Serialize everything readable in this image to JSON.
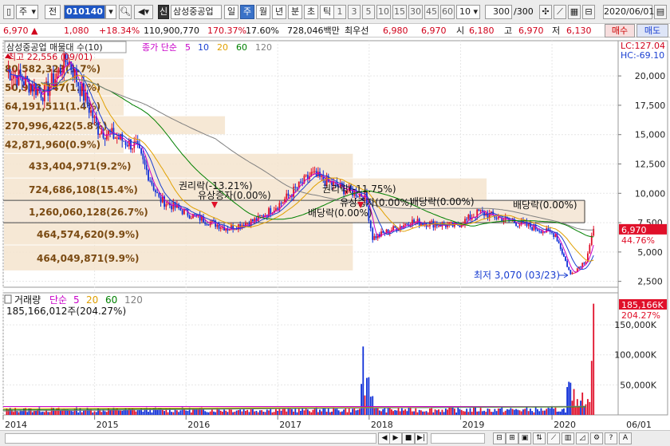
{
  "toolbar": {
    "period_select": "주",
    "prefix_btn": "전",
    "code": "010140",
    "stock_badge": "신",
    "stock_name": "삼성중공업",
    "intervals": [
      "일",
      "주",
      "월",
      "년",
      "분",
      "초",
      "틱"
    ],
    "active_interval": "주",
    "numbers": [
      "1",
      "3",
      "5",
      "10",
      "15",
      "30",
      "45",
      "60"
    ],
    "count_select": "10",
    "range_value": "300",
    "range_total": "/300",
    "date": "2020/06/01"
  },
  "quote": {
    "price": "6,970",
    "change": "1,080",
    "change_pct": "+18.34%",
    "volume": "110,900,770",
    "vol_ratio": "170.37%",
    "turnover": "17.60%",
    "amount": "728,046백만",
    "label_best": "최우선",
    "best1": "6,980",
    "best2": "6,970",
    "open_label": "시",
    "open": "6,180",
    "high_label": "고",
    "high": "6,970",
    "low_label": "저",
    "low": "6,130",
    "buy": "매수",
    "sell": "매도"
  },
  "price_panel": {
    "title": "삼성중공업 매물대 수(10)",
    "legend_prefix": "종가 단순",
    "ma_labels": [
      "5",
      "10",
      "20",
      "60",
      "120"
    ],
    "ma_colors": [
      "#c800c8",
      "#1a3fd1",
      "#e0a000",
      "#008000",
      "#808080"
    ],
    "high_note": "최고 22,556 (09/01)",
    "low_note": "최저 3,070 (03/23)",
    "lc": "LC:127.04",
    "hc": "HC:-69.10",
    "y_ticks": [
      "20,000",
      "17,500",
      "15,000",
      "12,500",
      "10,000",
      "7,500",
      "5,000",
      "2,500"
    ],
    "current_price": "6,970",
    "current_pct": "44.76%",
    "volume_profile": [
      "80,582,323(1.7%)",
      "50,913,147(1.1%)",
      "64,191,511(1.4%)",
      "270,996,422(5.8%)",
      "42,871,960(0.9%)",
      "433,404,971(9.2%)",
      "724,686,108(15.4%)",
      "1,260,060,128(26.7%)",
      "464,574,620(9.9%)",
      "464,049,871(9.9%)"
    ],
    "events": [
      "권리락(-13.21%)",
      "유상증자(0.00%)",
      "권리락(-11.75%)",
      "배당락(0.00%)",
      "유상증자(0.00%)",
      "배당락(0.00%)",
      "배당락(0.00%)"
    ]
  },
  "volume_panel": {
    "title": "거래량",
    "legend_prefix": "단순",
    "ma_labels": [
      "5",
      "20",
      "60",
      "120"
    ],
    "ma_colors": [
      "#c800c8",
      "#e0a000",
      "#008000",
      "#808080"
    ],
    "last_value": "185,166,012주(204.27%)",
    "badge_value": "185,166K",
    "badge_pct": "204.27%",
    "y_ticks": [
      "150,000K",
      "100,000K",
      "50,000K"
    ]
  },
  "x_axis": {
    "labels": [
      "2014",
      "2015",
      "2016",
      "2017",
      "2018",
      "2019",
      "2020"
    ],
    "right_date": "06/01"
  },
  "chart_data": {
    "type": "candlestick",
    "weekly_close_approx": [
      {
        "x": "2014-01",
        "y": 20500
      },
      {
        "x": "2014-06",
        "y": 18500
      },
      {
        "x": "2014-09",
        "y": 21500
      },
      {
        "x": "2015-01",
        "y": 15500
      },
      {
        "x": "2015-06",
        "y": 14000
      },
      {
        "x": "2015-09",
        "y": 9500
      },
      {
        "x": "2016-01",
        "y": 8200
      },
      {
        "x": "2016-06",
        "y": 7000
      },
      {
        "x": "2016-10",
        "y": 7800
      },
      {
        "x": "2017-01",
        "y": 9200
      },
      {
        "x": "2017-05",
        "y": 11600
      },
      {
        "x": "2017-09",
        "y": 10400
      },
      {
        "x": "2017-12",
        "y": 9800
      },
      {
        "x": "2018-01",
        "y": 6200
      },
      {
        "x": "2018-06",
        "y": 7600
      },
      {
        "x": "2018-12",
        "y": 7200
      },
      {
        "x": "2019-03",
        "y": 8400
      },
      {
        "x": "2019-09",
        "y": 7300
      },
      {
        "x": "2020-01",
        "y": 6500
      },
      {
        "x": "2020-03",
        "y": 3070
      },
      {
        "x": "2020-05",
        "y": 4300
      },
      {
        "x": "2020-06",
        "y": 6970
      }
    ],
    "ylim": [
      2000,
      23000
    ],
    "volume_ylim": [
      0,
      190000000
    ],
    "volume_last": 185166012
  }
}
